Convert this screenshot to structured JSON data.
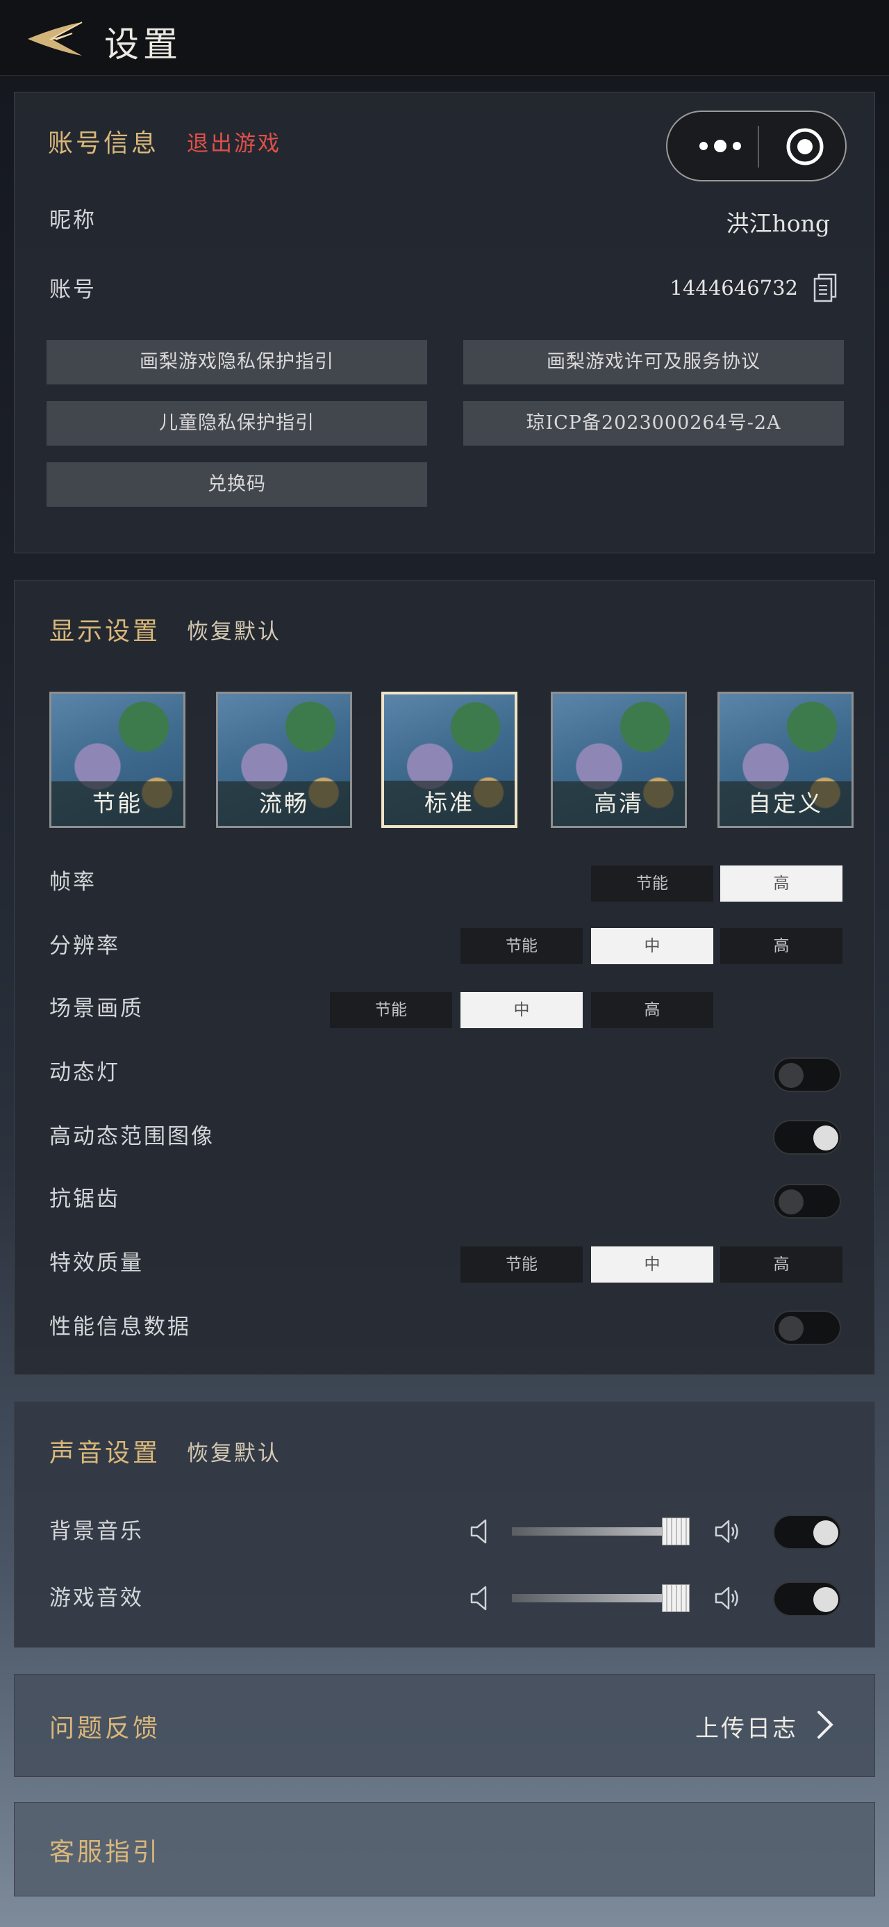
{
  "header": {
    "title": "设置"
  },
  "account": {
    "title": "账号信息",
    "logout": "退出游戏",
    "nickname_label": "昵称",
    "nickname_value": "洪江hong",
    "account_label": "账号",
    "account_value": "1444646732",
    "links": [
      "画梨游戏隐私保护指引",
      "画梨游戏许可及服务协议",
      "儿童隐私保护指引",
      "琼ICP备2023000264号-2A",
      "兑换码"
    ]
  },
  "display": {
    "title": "显示设置",
    "reset": "恢复默认",
    "presets": [
      {
        "label": "节能",
        "selected": false
      },
      {
        "label": "流畅",
        "selected": false
      },
      {
        "label": "标准",
        "selected": true
      },
      {
        "label": "高清",
        "selected": false
      },
      {
        "label": "自定义",
        "selected": false
      }
    ],
    "framerate": {
      "label": "帧率",
      "options": [
        "节能",
        "高"
      ],
      "selected": "高"
    },
    "resolution": {
      "label": "分辨率",
      "options": [
        "节能",
        "中",
        "高"
      ],
      "selected": "中"
    },
    "scene_quality": {
      "label": "场景画质",
      "options": [
        "节能",
        "中",
        "高"
      ],
      "selected": "中"
    },
    "dynamic_light": {
      "label": "动态灯",
      "on": false
    },
    "hdr": {
      "label": "高动态范围图像",
      "on": true
    },
    "antialias": {
      "label": "抗锯齿",
      "on": false
    },
    "effects": {
      "label": "特效质量",
      "options": [
        "节能",
        "中",
        "高"
      ],
      "selected": "中"
    },
    "perf_info": {
      "label": "性能信息数据",
      "on": false
    }
  },
  "sound": {
    "title": "声音设置",
    "reset": "恢复默认",
    "bgm": {
      "label": "背景音乐",
      "level": 0.95,
      "on": true
    },
    "sfx": {
      "label": "游戏音效",
      "level": 0.95,
      "on": true
    }
  },
  "feedback": {
    "title": "问题反馈",
    "action": "上传日志"
  },
  "support": {
    "title": "客服指引"
  },
  "colors": {
    "gold": "#d9b77a",
    "logout_red": "#e0504a"
  }
}
